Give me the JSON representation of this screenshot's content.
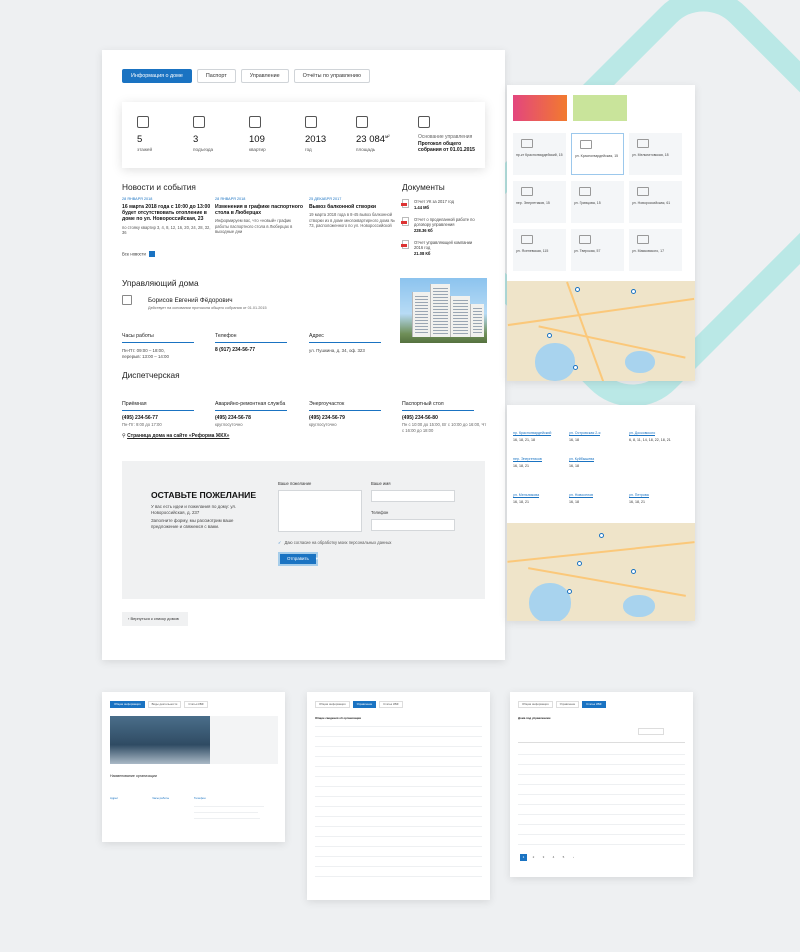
{
  "tabs": [
    "Информация о доме",
    "Паспорт",
    "Управление",
    "Отчёты по управлению"
  ],
  "stats": [
    {
      "icon": "phone-icon",
      "value": "5",
      "label": "этажей"
    },
    {
      "icon": "door-icon",
      "value": "3",
      "label": "подъезда"
    },
    {
      "icon": "key-icon",
      "value": "109",
      "label": "квартир"
    },
    {
      "icon": "calendar-icon",
      "value": "2013",
      "label": "год"
    },
    {
      "icon": "area-icon",
      "value": "23 084",
      "unit": "м²",
      "label": "площадь"
    },
    {
      "icon": "document-icon",
      "label": "Основание управления",
      "text": "Протокол общего собрания от 01.01.2015"
    }
  ],
  "news": {
    "heading": "Новости и события",
    "items": [
      {
        "date": "28 ЯНВАРЯ 2018",
        "title": "16 марта 2018 года с 10:00 до 13:00 будет отсутствовать отопление в доме по ул. Новороссийская, 23",
        "body": "по стояку квартир 3, 4, 8, 12, 16, 20, 24, 28, 32, 36"
      },
      {
        "date": "28 ЯНВАРЯ 2018",
        "title": "Изменения в графике паспортного стола в Люберцах",
        "body": "Информируем вас, что «новый» график работы паспортного стола в Люберцах в выходные дни"
      },
      {
        "date": "25 ДЕКАБРЯ 2017",
        "title": "Вывоз балконной створки",
        "body": "19 марта 2018 года в 8-45 вывоз балконной створки из в доме многоквартирного дома № 73, расположенного по ул. Новороссийской"
      }
    ],
    "all_label": "Все новости"
  },
  "documents": {
    "heading": "Документы",
    "items": [
      {
        "title": "Отчет УК за 2017 год",
        "size": "1.44 Мб"
      },
      {
        "title": "Отчет о проделанной работе по договору управления",
        "size": "228.36 Кб"
      },
      {
        "title": "Отчет управляющей компании 2016 год",
        "size": "21.08 Кб"
      }
    ]
  },
  "manager": {
    "heading": "Управляющий дома",
    "name": "Борисов Евгений Фёдорович",
    "note": "Действует на основании протокола общего собрания от 01.01.2015",
    "hours_label": "Часы работы",
    "hours": "Пн-Пт: 09:00 – 18:00,",
    "break": "перерыв: 13:00 – 14:00",
    "phone_label": "Телефон",
    "phone": "8 (917) 234-56-77",
    "address_label": "Адрес",
    "address": "ул. Пушкина, д. 34, оф. 323"
  },
  "dispatch": {
    "heading": "Диспетчерская",
    "items": [
      {
        "label": "Приёмная",
        "phone": "(495) 234-56-77",
        "note": "Пн-Пт: 9:00 до 17:00"
      },
      {
        "label": "Аварийно-ремонтная служба",
        "phone": "(495) 234-56-78",
        "note": "круглосуточно"
      },
      {
        "label": "Энергоучасток",
        "phone": "(495) 234-56-79",
        "note": "круглосуточно"
      },
      {
        "label": "Паспортный стол",
        "phone": "(495) 234-56-80",
        "note": "Пн с 10:00 до 15:00, Вт с 10:00 до 16:00, Чт с 16:00 до 18:00"
      }
    ]
  },
  "reform_link": "Страница дома на сайте «Реформа ЖКХ»",
  "feedback": {
    "title": "ОСТАВЬТЕ ПОЖЕЛАНИЕ",
    "text1": "У вас есть идеи и пожелания по дому: ул. Новороссийская, д. 237",
    "text2": "Заполните форму, мы рассмотрим ваше предложение и свяжемся с вами.",
    "wish_label": "Ваше пожелание",
    "name_label": "Ваше имя",
    "phone_label": "Телефон",
    "agree": "Даю согласие на обработку моих персональных данных",
    "send": "Отправить"
  },
  "back_label": "‹ Вернуться к списку домов",
  "cards": [
    "пр-кт Красногвардейский, 15",
    "ул. Красногвардейская, 15",
    "ул. Мельнитовская, 18",
    "пер. Энергетиков, 15",
    "ул. Гривцова, 15",
    "ул. Новороссийская, 61",
    "ул. Ясеневская, 115",
    "ул. Тверская, 57",
    "ул. Маяковского, 17"
  ],
  "addresses": [
    {
      "street": "пр. Красногвардейский",
      "nums": "16, 18, 21, 18"
    },
    {
      "street": "ул. Островская 2-я",
      "nums": "16, 18"
    },
    {
      "street": "ул. Досковского",
      "nums": "6, 8, 11, 14, 18, 22, 18, 21"
    },
    {
      "street": "пер. Энергетиков",
      "nums": "16, 18, 21"
    },
    {
      "street": "ул. Куйбышева",
      "nums": "16, 18"
    },
    {
      "street": "ул. Мельникова",
      "nums": "16, 18, 21"
    },
    {
      "street": "ул. Новоселов",
      "nums": "16, 18"
    },
    {
      "street": "ул. Петрова",
      "nums": "16, 18, 21"
    }
  ],
  "bottom1": {
    "tabs": [
      "Общая информация",
      "Виды деятельности",
      "Статья КБФ"
    ],
    "org": "Наименование организации",
    "col1": "Адрес",
    "col2": "Часы работы",
    "col3": "Телефон"
  },
  "bottom2": {
    "tabs": [
      "Общая информация",
      "Управление",
      "Статья КБФ"
    ],
    "title": "Общие сведения об организации"
  },
  "bottom3": {
    "tabs": [
      "Общая информация",
      "Управление",
      "Статья КБФ"
    ],
    "title": "Дома под управлением",
    "pages": [
      "1",
      "2",
      "3",
      "4",
      "5",
      "›"
    ]
  }
}
